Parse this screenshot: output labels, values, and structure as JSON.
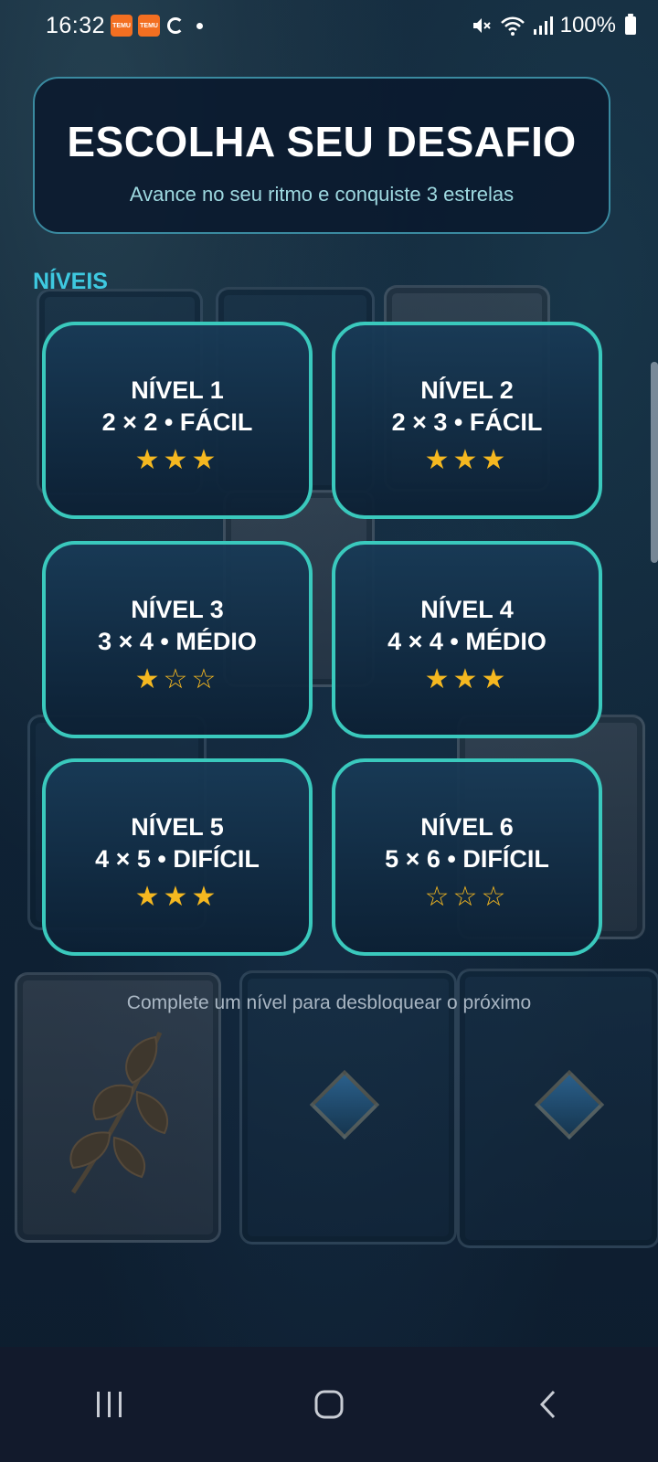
{
  "status_bar": {
    "time": "16:32",
    "battery": "100%",
    "icons": [
      "temu-app-icon",
      "temu-app-icon",
      "sync-icon",
      "notification-dot",
      "mute-icon",
      "wifi-icon",
      "signal-icon",
      "battery-icon"
    ]
  },
  "header": {
    "title": "ESCOLHA SEU DESAFIO",
    "subtitle": "Avance no seu ritmo e conquiste 3 estrelas"
  },
  "section_label": "NÍVEIS",
  "levels": [
    {
      "name": "NÍVEL 1",
      "info": "2 × 2  •  FÁCIL",
      "stars": "★★★"
    },
    {
      "name": "NÍVEL 2",
      "info": "2 × 3  •  FÁCIL",
      "stars": "★★★"
    },
    {
      "name": "NÍVEL 3",
      "info": "3 × 4  •  MÉDIO",
      "stars": "★☆☆"
    },
    {
      "name": "NÍVEL 4",
      "info": "4 × 4  •  MÉDIO",
      "stars": "★★★"
    },
    {
      "name": "NÍVEL 5",
      "info": "4 × 5  •  DIFÍCIL",
      "stars": "★★★"
    },
    {
      "name": "NÍVEL 6",
      "info": "5 × 6  •  DIFÍCIL",
      "stars": "☆☆☆"
    }
  ],
  "hint": "Complete um nível para desbloquear o próximo",
  "colors": {
    "accent_border": "#3ac9bd",
    "section_label": "#3ec9e0",
    "star": "#f5b820",
    "panel_border": "#3a8aa0"
  },
  "navbar": {
    "icons": [
      "recent-apps-icon",
      "home-icon",
      "back-icon"
    ]
  }
}
